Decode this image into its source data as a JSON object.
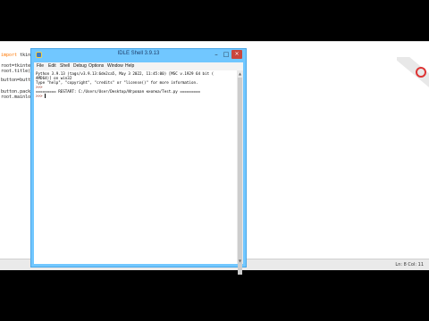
{
  "editor": {
    "lines": [
      {
        "prefix": "import ",
        "rest": "tkint"
      },
      {
        "prefix": "",
        "rest": ""
      },
      {
        "prefix": "",
        "rest": "root=tkinte"
      },
      {
        "prefix": "",
        "rest": "root.title("
      },
      {
        "prefix": "",
        "rest": ""
      },
      {
        "prefix": "",
        "rest": "button=butt"
      },
      {
        "prefix": "",
        "rest": ""
      },
      {
        "prefix": "",
        "rest": "button.pack"
      },
      {
        "prefix": "",
        "rest": "root.mainlo"
      }
    ],
    "status": "Ln: 8   Col: 11"
  },
  "shell": {
    "title": "IDLE Shell 3.9.13",
    "buttons": {
      "minimize": "–",
      "maximize": "□",
      "close": "×"
    },
    "menu": [
      "File",
      "Edit",
      "Shell",
      "Debug",
      "Options",
      "Window",
      "Help"
    ],
    "lines": [
      "Python 3.9.13 (tags/v3.9.13:6de2ca5, May  3 2022, 11:45:00) [MSC v.1929 64 bit (",
      "AMD64)] on win32",
      "Type \"help\", \"copyright\", \"credits\" or \"license()\" for more information.",
      ">>>",
      "========= RESTART: C:/Users/User/Desktop/Игровая кнопка/Test.py =========",
      ">>>"
    ]
  },
  "colors": {
    "window_frame": "#71c7ff",
    "close_button": "#c9463d",
    "prompt": "#8a1a0a",
    "editor_keyword": "#ff7700"
  },
  "icons": [
    "idle-app-icon",
    "minimize-icon",
    "maximize-icon",
    "close-icon",
    "scroll-up-icon",
    "scroll-down-icon"
  ]
}
